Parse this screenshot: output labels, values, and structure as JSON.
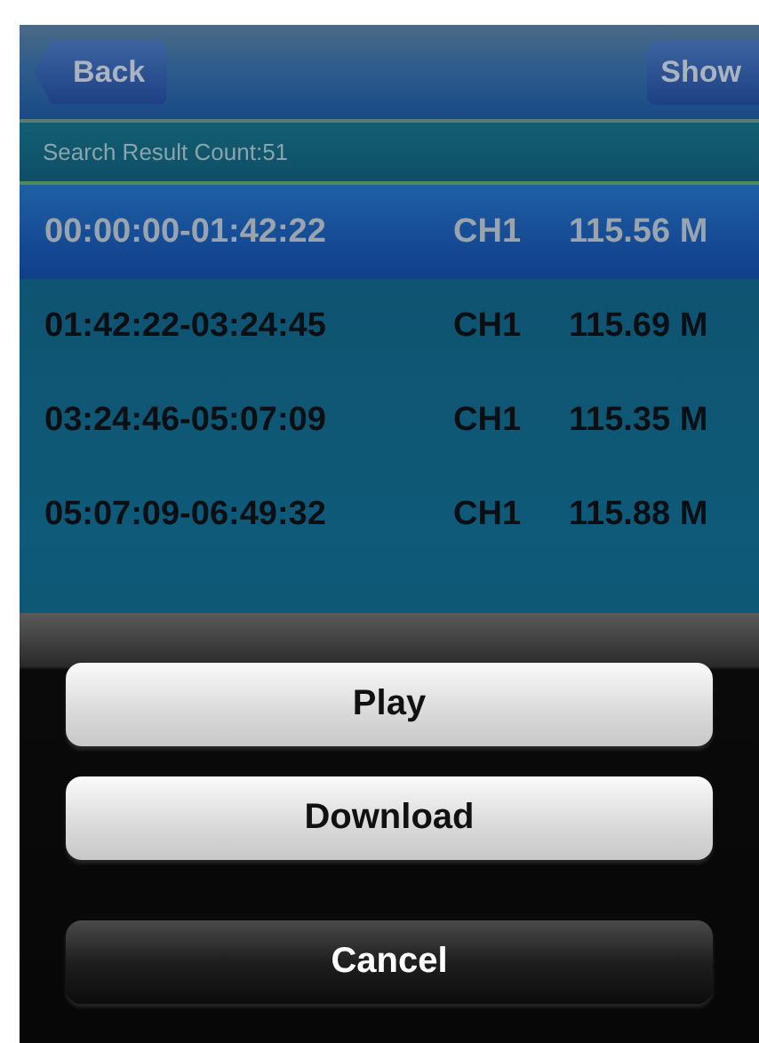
{
  "nav_bar": {
    "back_button": "Back",
    "right_button": "Show"
  },
  "result_count": "Search Result Count:51",
  "rows": [
    {
      "time_range": "00:00:00-01:42:22",
      "channel": "CH1",
      "size": "115.56 M",
      "selected": true
    },
    {
      "time_range": "01:42:22-03:24:45",
      "channel": "CH1",
      "size": "115.69 M",
      "selected": false
    },
    {
      "time_range": "03:24:46-05:07:09",
      "channel": "CH1",
      "size": "115.35 M",
      "selected": false
    },
    {
      "time_range": "05:07:09-06:49:32",
      "channel": "CH1",
      "size": "115.88 M",
      "selected": false
    }
  ],
  "action_sheet": {
    "buttons": [
      {
        "label": "Play",
        "kind": "default"
      },
      {
        "label": "Download",
        "kind": "default"
      },
      {
        "label": "Cancel",
        "kind": "cancel"
      }
    ]
  }
}
